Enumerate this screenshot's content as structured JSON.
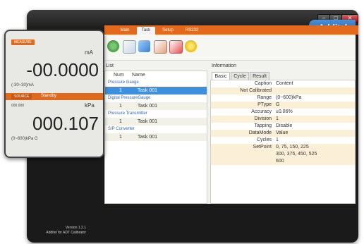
{
  "app": {
    "brand": "Additel",
    "version_line1": "Version 1.2.1",
    "version_line2": "Additel for ADT Calibrator"
  },
  "main_tabs": [
    {
      "label": "Main",
      "active": false
    },
    {
      "label": "Task",
      "active": true
    },
    {
      "label": "Setup",
      "active": false
    },
    {
      "label": "RS232",
      "active": false
    }
  ],
  "toolbar": {
    "icons": [
      "refresh-icon",
      "import-icon",
      "edit-task-icon",
      "export-icon",
      "delete-icon",
      "star-icon"
    ]
  },
  "list": {
    "title": "List",
    "col_num": "Num",
    "col_name": "Name",
    "groups": [
      {
        "label": "Pressure Gauge",
        "items": [
          {
            "num": "1",
            "name": "Task 001",
            "selected": true
          }
        ]
      },
      {
        "label": "Digital PressureGauge",
        "items": [
          {
            "num": "1",
            "name": "Task 001",
            "selected": false
          }
        ]
      },
      {
        "label": "Pressure Transmitter",
        "items": [
          {
            "num": "1",
            "name": "Task 001",
            "selected": false
          }
        ]
      },
      {
        "label": "S/P Converter",
        "items": [
          {
            "num": "1",
            "name": "Task 001",
            "selected": false
          }
        ]
      }
    ]
  },
  "info": {
    "title": "Information",
    "tabs": [
      "Basic",
      "Cycle",
      "Result"
    ],
    "rows": [
      {
        "key": "Caption",
        "value": "Content"
      },
      {
        "key": "Not Calibrated",
        "value": ""
      },
      {
        "key": "Range",
        "value": "(0~600)kPa"
      },
      {
        "key": "PType",
        "value": "G"
      },
      {
        "key": "Accuracy",
        "value": "±0.06%"
      },
      {
        "key": "Division",
        "value": "1"
      },
      {
        "key": "Tapping",
        "value": "Disable"
      },
      {
        "key": "DataMode",
        "value": "Value"
      },
      {
        "key": "Cycles",
        "value": "1"
      },
      {
        "key": "SetPoint",
        "value": "0, 75, 150, 225"
      },
      {
        "key": "",
        "value": "300, 375, 450, 525"
      },
      {
        "key": "",
        "value": "600"
      }
    ]
  },
  "device": {
    "measure_label": "MEASURE",
    "measure_unit": "mA",
    "measure_value": "-00.0000",
    "measure_range": "(-30~30)mA",
    "source_label": "SOURCE",
    "source_mode": "Standby",
    "source_small": "000.000",
    "source_unit": "kPa",
    "source_value": "000.107",
    "source_range": "(0~600)kPa G"
  },
  "colors": {
    "accent": "#e36a1c",
    "selection": "#3d8fe0",
    "brand": "#2a6fc0"
  }
}
